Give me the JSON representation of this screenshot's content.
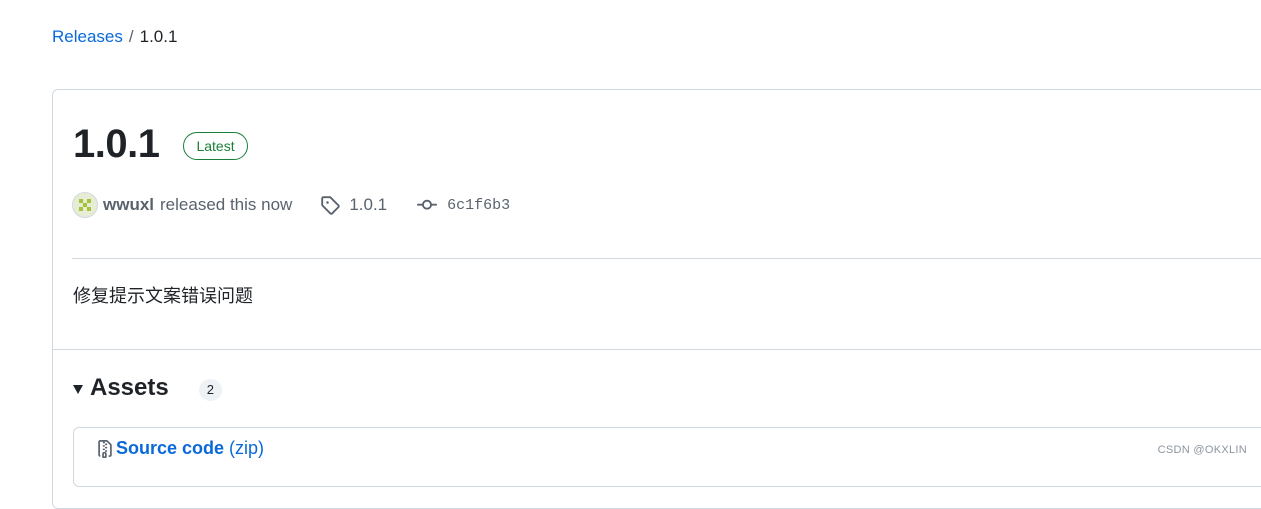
{
  "breadcrumb": {
    "parent": "Releases",
    "separator": "/",
    "current": "1.0.1"
  },
  "release": {
    "title": "1.0.1",
    "badge": "Latest",
    "author": "wwuxl",
    "released_text": "released this now",
    "tag": "1.0.1",
    "commit": "6c1f6b3",
    "body": "修复提示文案错误问题"
  },
  "assets": {
    "title": "Assets",
    "count": "2",
    "items": [
      {
        "name": "Source code",
        "ext": "(zip)",
        "icon": "file-zip-icon"
      }
    ]
  },
  "watermark": "CSDN @OKXLIN",
  "colors": {
    "link": "#0969da",
    "latest_green": "#1a7f37",
    "muted": "#59636e",
    "border": "#d1d9e0"
  }
}
